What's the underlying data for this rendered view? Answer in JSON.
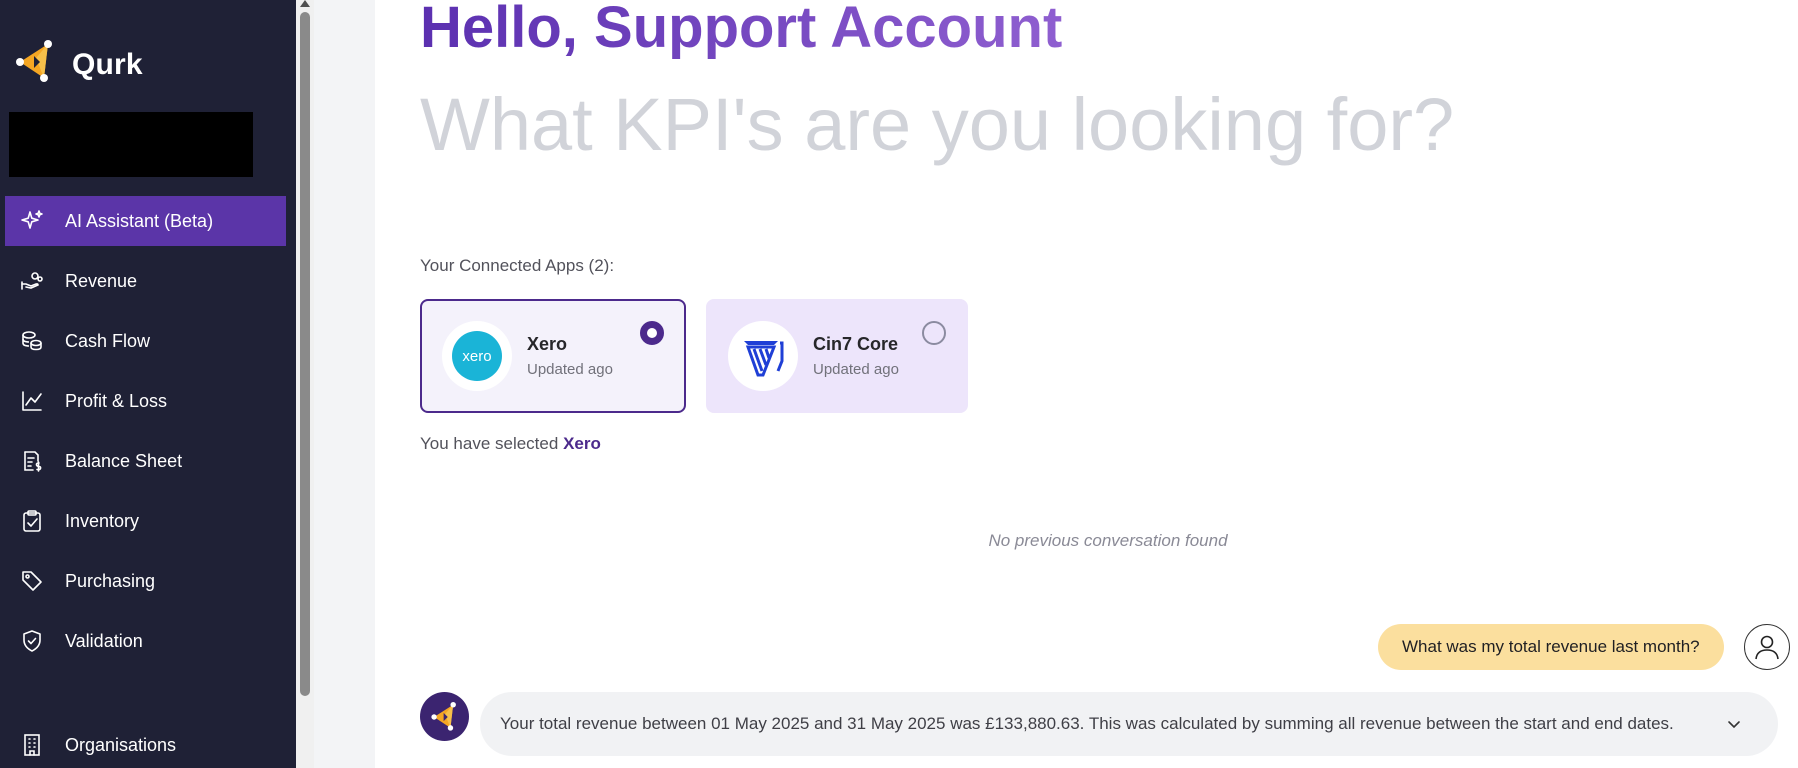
{
  "brand": {
    "name": "Qurk",
    "logo_icon": "qurk-logo-icon"
  },
  "sidebar": {
    "items": [
      {
        "label": "AI Assistant (Beta)",
        "icon": "sparkles-icon",
        "active": true
      },
      {
        "label": "Revenue",
        "icon": "hand-coins-icon"
      },
      {
        "label": "Cash Flow",
        "icon": "coins-icon"
      },
      {
        "label": "Profit & Loss",
        "icon": "line-chart-icon"
      },
      {
        "label": "Balance Sheet",
        "icon": "receipt-icon"
      },
      {
        "label": "Inventory",
        "icon": "clipboard-check-icon"
      },
      {
        "label": "Purchasing",
        "icon": "tag-icon"
      },
      {
        "label": "Validation",
        "icon": "shield-check-icon"
      }
    ],
    "bottom_item": {
      "label": "Organisations",
      "icon": "building-icon"
    }
  },
  "main": {
    "greeting": "Hello, Support Account",
    "kpi_placeholder": "What KPI's are you looking for?",
    "connected_apps_label": "Your Connected Apps (2):",
    "apps": [
      {
        "name": "Xero",
        "updated": "Updated  ago",
        "logo_text": "xero",
        "selected": true
      },
      {
        "name": "Cin7 Core",
        "updated": "Updated  ago",
        "selected": false
      }
    ],
    "selected_prefix": "You have selected",
    "selected_app": "Xero",
    "no_conversation": "No previous conversation found",
    "user_message": "What was my total revenue last month?",
    "assistant_message": "Your total revenue between 01 May 2025 and 31 May 2025 was £133,880.63. This was calculated by summing all revenue between the start and end dates."
  },
  "colors": {
    "sidebar_bg": "#1f2136",
    "active_nav": "#5b35a8",
    "accent": "#4c2a8c",
    "user_bubble": "#fbdf9e",
    "xero_blue": "#1ab4d7",
    "cin7_blue": "#1f3fd6"
  }
}
